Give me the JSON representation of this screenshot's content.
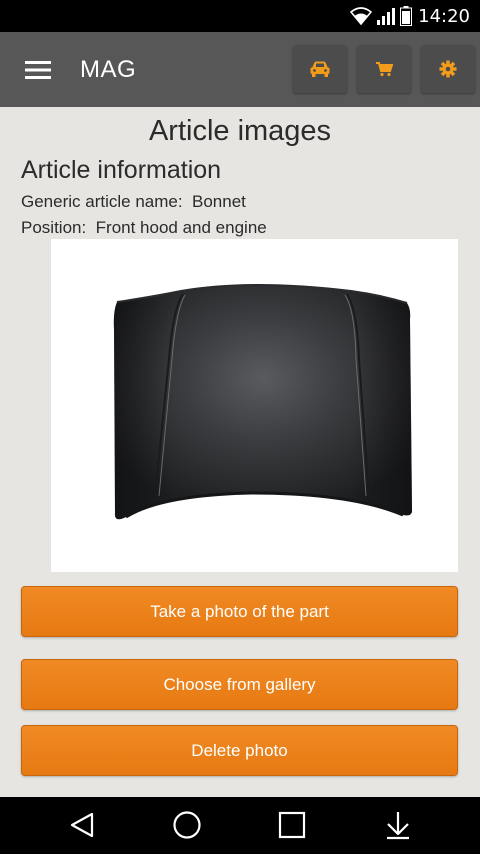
{
  "status_bar": {
    "time": "14:20",
    "icons": [
      "wifi-icon",
      "signal-icon",
      "battery-icon"
    ]
  },
  "app_bar": {
    "title": "MAG",
    "menu_icon": "hamburger-menu-icon",
    "actions": [
      "car-icon",
      "shopping-cart-icon",
      "gear-icon"
    ],
    "accent_color": "#f39c1c"
  },
  "page": {
    "title": "Article images",
    "section_heading": "Article information",
    "generic_name_line": "Generic article name:  Bonnet",
    "position_line": "Position:  Front hood and engine"
  },
  "image": {
    "subject": "black car bonnet"
  },
  "buttons": {
    "take_photo": "Take a photo of the part",
    "choose_gallery": "Choose from gallery",
    "delete_photo": "Delete photo",
    "color": "#ec8019"
  },
  "nav_bar": {
    "icons": [
      "back-icon",
      "home-icon",
      "recents-icon",
      "hide-keyboard-icon"
    ]
  }
}
